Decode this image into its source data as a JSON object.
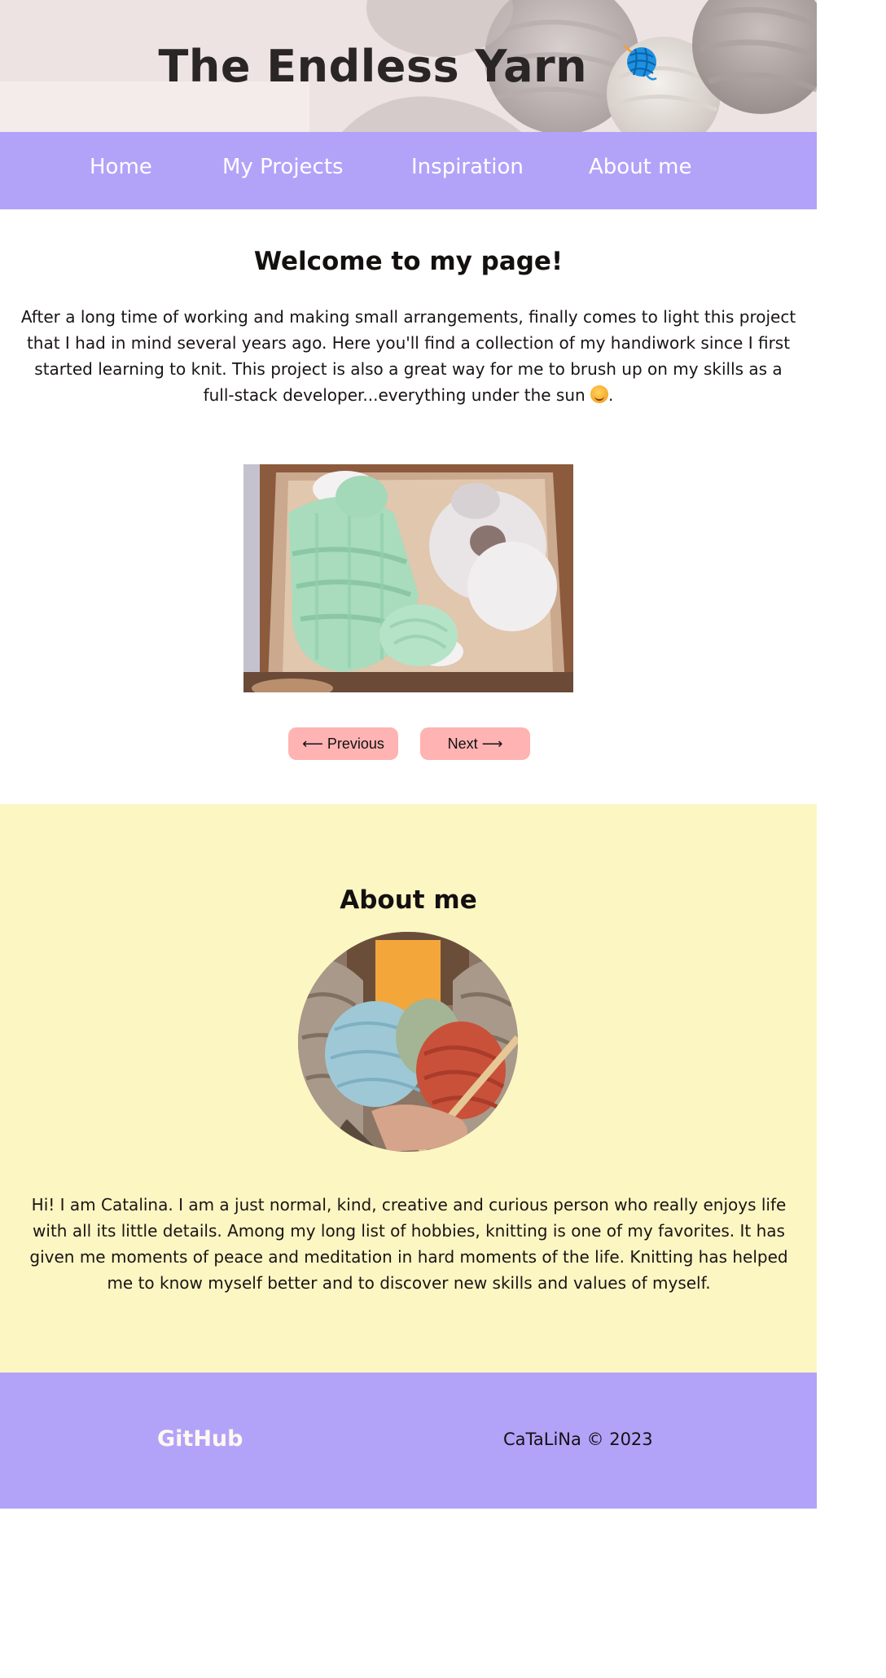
{
  "header": {
    "title": "The Endless Yarn",
    "title_icon": "yarn-ball-icon"
  },
  "nav": {
    "items": [
      {
        "label": "Home"
      },
      {
        "label": "My Projects"
      },
      {
        "label": "Inspiration"
      },
      {
        "label": "About me"
      }
    ]
  },
  "welcome": {
    "heading": "Welcome to my page!",
    "text": "After a long time of working and making small arrangements, finally comes to light this project that I had in mind several years ago. Here you'll find a collection of my handiwork since I first started learning to knit. This project is also a great way for me to brush up on my skills as a full-stack developer...everything under the sun",
    "text_end": ".",
    "emoji": "smiling-face-icon"
  },
  "carousel": {
    "image_subject": "knitted mint-green baby sweater with koala plush in a box",
    "prev_label": "⟵ Previous",
    "next_label": "Next ⟶"
  },
  "about": {
    "heading": "About me",
    "avatar_subject": "hands holding yarn balls and knitting needles",
    "text": "Hi! I am Catalina. I am a just normal, kind, creative and curious person who really enjoys life with all its little details. Among my long list of hobbies, knitting is one of my favorites. It has given me moments of peace and meditation in hard moments of the life. Knitting has helped me to know myself better and to discover new skills and values of myself."
  },
  "footer": {
    "github_label": "GitHub",
    "copyright": "CaTaLiNa © 2023"
  },
  "colors": {
    "nav_bg": "#b2a3f9",
    "about_bg": "#fcf6c3",
    "button_bg": "#ffb3b3",
    "footer_bg": "#b2a3f9"
  }
}
